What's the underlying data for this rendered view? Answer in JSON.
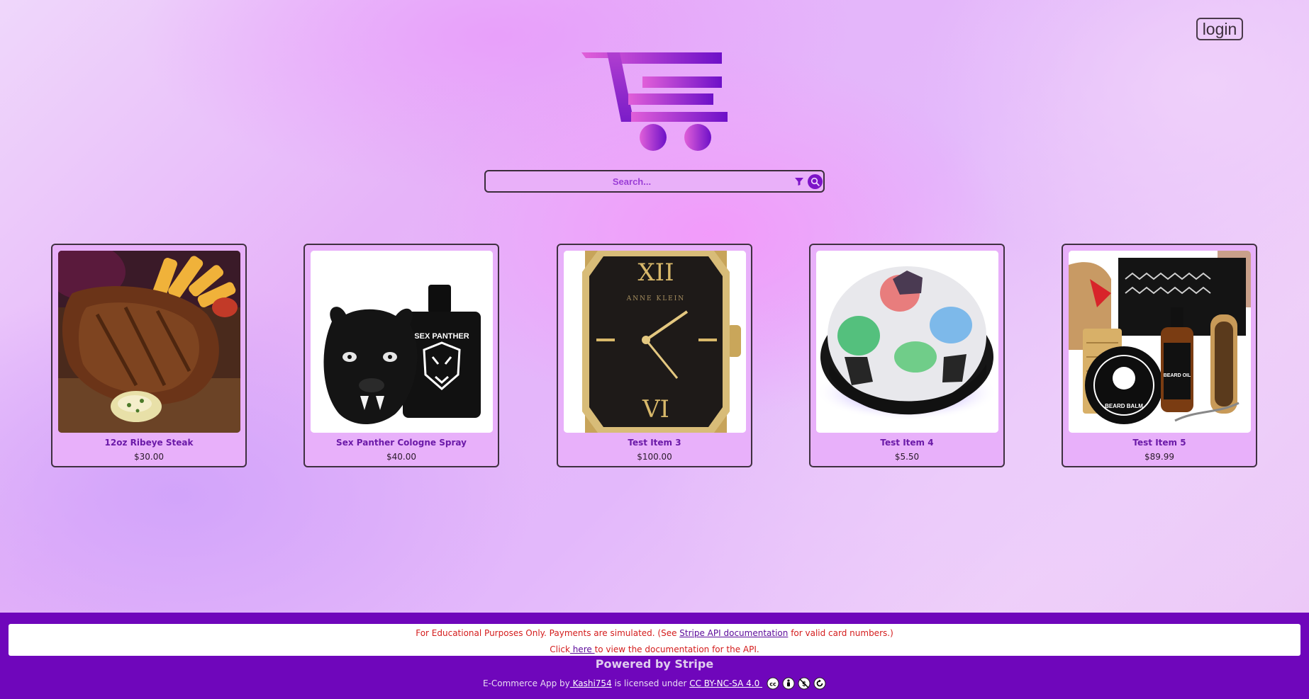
{
  "header": {
    "login_label": "login"
  },
  "search": {
    "placeholder": "Search..."
  },
  "products": [
    {
      "name": "12oz Ribeye Steak",
      "price": "$30.00",
      "image": "steak"
    },
    {
      "name": "Sex Panther Cologne Spray",
      "price": "$40.00",
      "image": "cologne"
    },
    {
      "name": "Test Item 3",
      "price": "$100.00",
      "image": "watch"
    },
    {
      "name": "Test Item 4",
      "price": "$5.50",
      "image": "hover-ball"
    },
    {
      "name": "Test Item 5",
      "price": "$89.99",
      "image": "beard-kit"
    }
  ],
  "product_image_text": {
    "cologne_brand": "SEX PANTHER",
    "watch_brand": "ANNE KLEIN",
    "watch_xii": "XII",
    "watch_vi": "VI",
    "kit_beard_oil": "BEARD OIL",
    "kit_beard_balm": "BEARD BALM"
  },
  "footer": {
    "notice_pre": "For Educational Purposes Only. Payments are simulated. (See ",
    "notice_link": "Stripe API documentation",
    "notice_post": " for valid card numbers.)",
    "click_pre": "Click",
    "click_link": " here ",
    "click_post": "to view the documentation for the API.",
    "powered": "Powered by Stripe",
    "license_pre": "E-Commerce App by",
    "author_link": " Kashi754",
    "license_mid": " is licensed under ",
    "license_link": "CC BY-NC-SA 4.0 "
  },
  "colors": {
    "accent": "#7d14c8",
    "footer_bg": "#6f06bb",
    "card_bg": "#e8b0fa",
    "notice_text": "#d41c1c"
  },
  "icons": [
    "cart-logo-icon",
    "filter-icon",
    "search-icon",
    "cc-icon",
    "cc-by-icon",
    "cc-nc-icon",
    "cc-sa-icon"
  ]
}
